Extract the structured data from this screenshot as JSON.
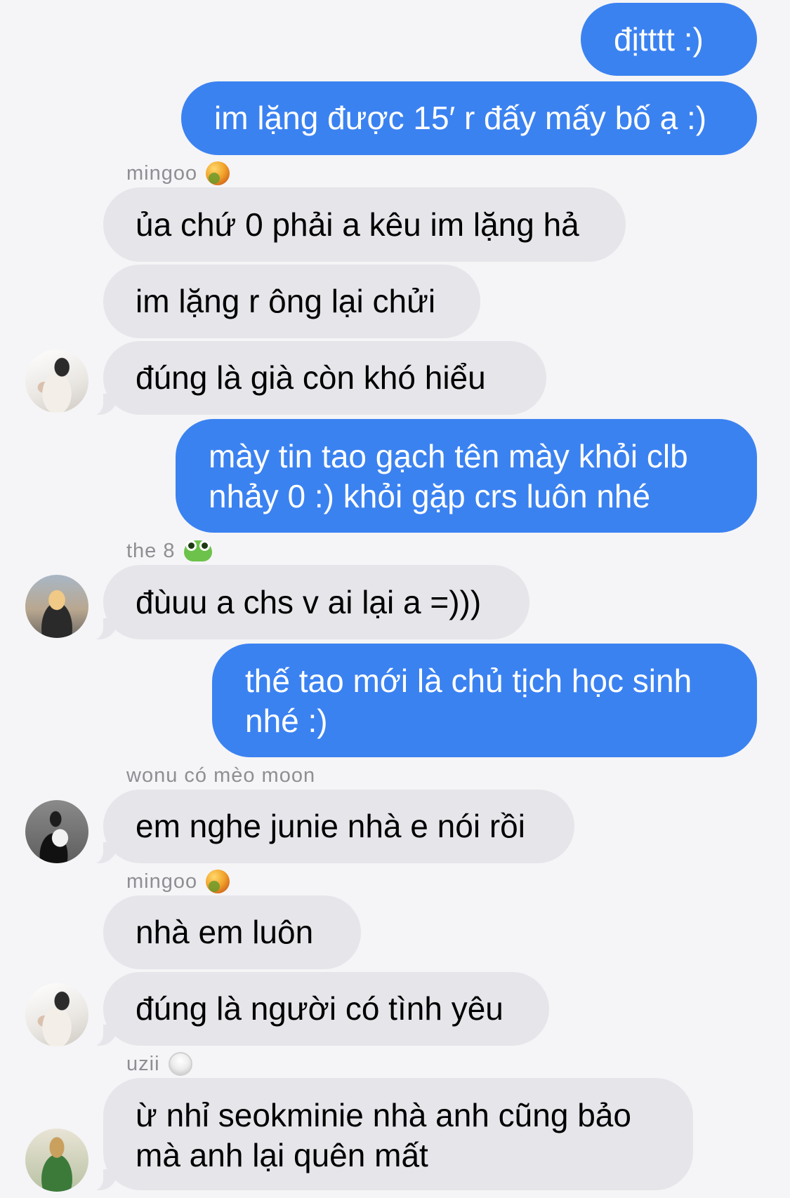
{
  "messages": {
    "m1": "địtttt :)",
    "m2": "im lặng được 15′ r đấy mấy bố ạ :)",
    "m3": "ủa chứ 0 phải a kêu im lặng hả",
    "m4": "im lặng r ông lại chửi",
    "m5": "đúng là già còn khó hiểu",
    "m6_line1": "mày tin tao gạch tên mày khỏi clb",
    "m6_line2": "nhảy 0 :) khỏi gặp crs luôn nhé",
    "m7": "đùuu a chs v ai lại a =)))",
    "m8_line1": "thế tao mới là chủ tịch học sinh",
    "m8_line2": "nhé :)",
    "m9": "em nghe junie nhà e nói rồi",
    "m10": "nhà em luôn",
    "m11": "đúng là người có tình yêu",
    "m12_line1": "ừ nhỉ seokminie nhà anh cũng bảo",
    "m12_line2": "mà anh lại quên mất"
  },
  "senders": {
    "mingoo": "mingoo",
    "the8": "the 8",
    "wonu": "wonu có mèo moon",
    "uzii": "uzii"
  },
  "sender_emojis": {
    "mingoo": "mango-icon",
    "the8": "frog-icon",
    "uzii": "rice-icon"
  },
  "colors": {
    "outgoing_bubble": "#3b82f1",
    "incoming_bubble": "#e5e5ea",
    "background": "#f5f5f7",
    "sender_name": "#8e8e93"
  }
}
